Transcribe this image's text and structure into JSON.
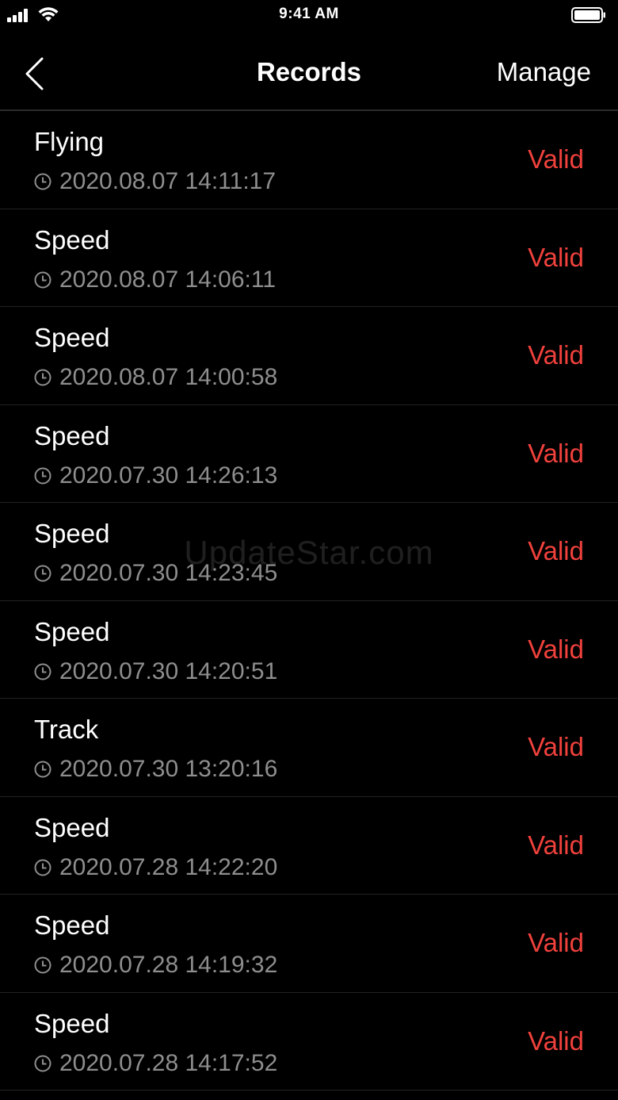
{
  "status_bar": {
    "time": "9:41 AM",
    "signal_icon": "cellular-signal-icon",
    "wifi_icon": "wifi-icon",
    "battery_icon": "battery-icon",
    "battery_level": 1.0
  },
  "nav": {
    "back_icon": "chevron-left-icon",
    "title": "Records",
    "manage_label": "Manage"
  },
  "colors": {
    "background": "#000000",
    "status_valid": "#f0413c",
    "timestamp": "#8e8e8e"
  },
  "records": [
    {
      "type": "Flying",
      "timestamp": "2020.08.07 14:11:17",
      "status": "Valid"
    },
    {
      "type": "Speed",
      "timestamp": "2020.08.07 14:06:11",
      "status": "Valid"
    },
    {
      "type": "Speed",
      "timestamp": "2020.08.07 14:00:58",
      "status": "Valid"
    },
    {
      "type": "Speed",
      "timestamp": "2020.07.30 14:26:13",
      "status": "Valid"
    },
    {
      "type": "Speed",
      "timestamp": "2020.07.30 14:23:45",
      "status": "Valid"
    },
    {
      "type": "Speed",
      "timestamp": "2020.07.30 14:20:51",
      "status": "Valid"
    },
    {
      "type": "Track",
      "timestamp": "2020.07.30 13:20:16",
      "status": "Valid"
    },
    {
      "type": "Speed",
      "timestamp": "2020.07.28 14:22:20",
      "status": "Valid"
    },
    {
      "type": "Speed",
      "timestamp": "2020.07.28 14:19:32",
      "status": "Valid"
    },
    {
      "type": "Speed",
      "timestamp": "2020.07.28 14:17:52",
      "status": "Valid"
    }
  ],
  "watermark": "UpdateStar.com"
}
